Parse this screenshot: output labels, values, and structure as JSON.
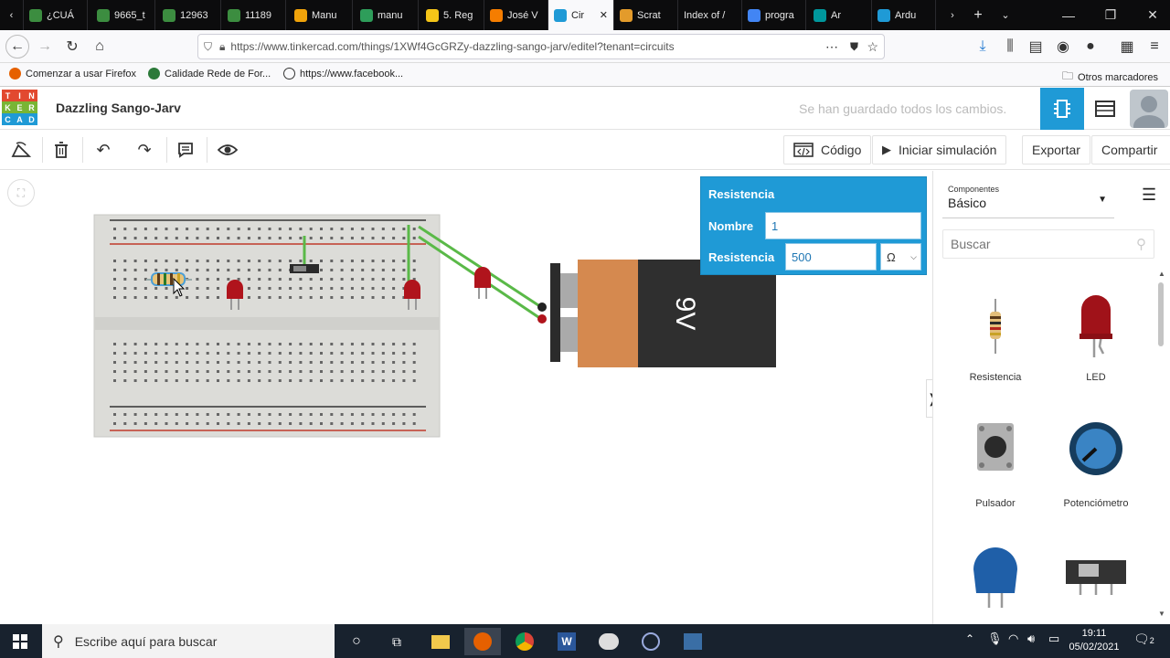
{
  "browser": {
    "tabs": [
      {
        "label": "¿CUÁ",
        "icon": "drive-icon",
        "color": "#3c8d40"
      },
      {
        "label": "9665_t",
        "icon": "drive-icon",
        "color": "#3c8d40"
      },
      {
        "label": "12963",
        "icon": "drive-icon",
        "color": "#3c8d40"
      },
      {
        "label": "11189",
        "icon": "drive-icon",
        "color": "#3c8d40"
      },
      {
        "label": "Manu",
        "icon": "circle-icon",
        "color": "#f0a30a"
      },
      {
        "label": "manu",
        "icon": "sheet-icon",
        "color": "#2e9d5a"
      },
      {
        "label": "5. Reg",
        "icon": "hand-icon",
        "color": "#f5c518"
      },
      {
        "label": "José V",
        "icon": "blogger-icon",
        "color": "#f57d00"
      },
      {
        "label": "Cir",
        "icon": "tinkercad-icon",
        "color": "#1f9ad6"
      },
      {
        "label": "Scrat",
        "icon": "scratch-icon",
        "color": "#e39b2b"
      },
      {
        "label": "Index of /",
        "icon": "none",
        "color": "#888888"
      },
      {
        "label": "progra",
        "icon": "google-icon",
        "color": "#4285f4"
      },
      {
        "label": "Ar",
        "icon": "arduino-icon",
        "color": "#00979c"
      },
      {
        "label": "Ardu",
        "icon": "tinkercad-icon",
        "color": "#1f9ad6"
      }
    ],
    "url": "https://www.tinkercad.com/things/1XWf4GcGRZy-dazzling-sango-jarv/editel?tenant=circuits",
    "bookmarks": [
      "Comenzar a usar Firefox",
      "Calidade Rede de For...",
      "https://www.facebook..."
    ],
    "other_bookmarks": "Otros marcadores"
  },
  "app": {
    "logo_letters": [
      "T",
      "I",
      "N",
      "K",
      "E",
      "R",
      "C",
      "A",
      "D"
    ],
    "logo_colors": [
      "#e2492f",
      "#e2492f",
      "#e2492f",
      "#79b535",
      "#79b535",
      "#79b535",
      "#1f9ad6",
      "#1f9ad6",
      "#1f9ad6"
    ],
    "project_title": "Dazzling Sango-Jarv",
    "save_status": "Se han guardado todos los cambios.",
    "accent": "#1f9ad6"
  },
  "toolbar": {
    "code_label": "Código",
    "simulate_label": "Iniciar simulación",
    "export_label": "Exportar",
    "share_label": "Compartir"
  },
  "properties": {
    "title": "Resistencia",
    "name_label": "Nombre",
    "name_value": "1",
    "resistance_label": "Resistencia",
    "resistance_value": "500",
    "unit": "Ω"
  },
  "circuit": {
    "battery_label": "9V"
  },
  "sidebar": {
    "components_small": "Componentes",
    "components_value": "Básico",
    "search_placeholder": "Buscar",
    "components": [
      "Resistencia",
      "LED",
      "Pulsador",
      "Potenciómetro",
      "",
      ""
    ]
  },
  "taskbar": {
    "search_placeholder": "Escribe aquí para buscar",
    "time": "19:11",
    "date": "05/02/2021",
    "notifications": "2"
  }
}
